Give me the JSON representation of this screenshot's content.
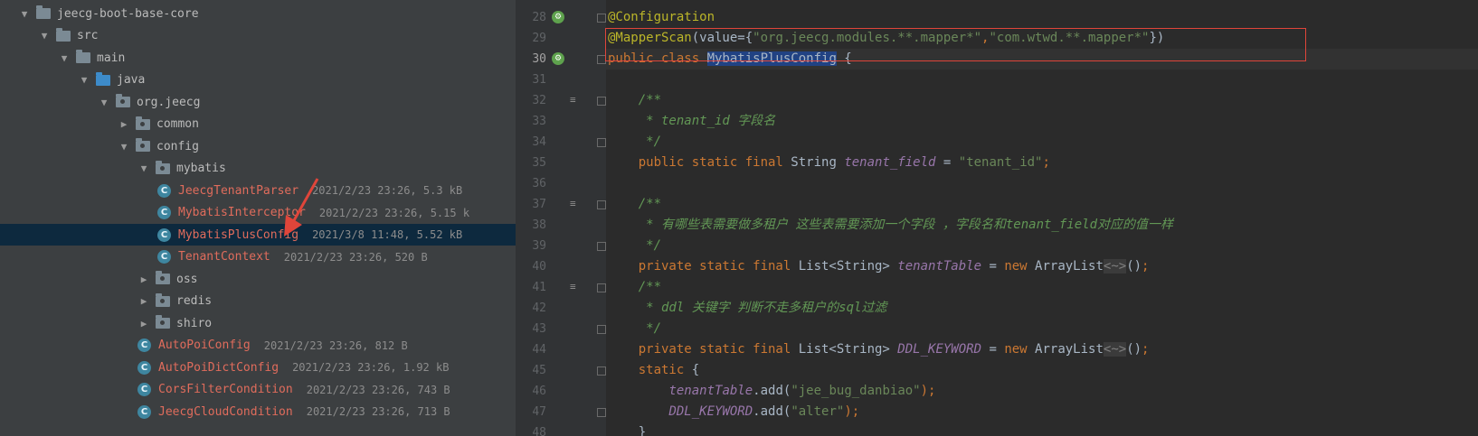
{
  "project_tree": {
    "rows": [
      {
        "label": "jeecg-boot-base-core",
        "meta": "",
        "expanded": true,
        "icon": "module-folder-icon",
        "depth": 0
      },
      {
        "label": "src",
        "meta": "",
        "expanded": true,
        "icon": "folder-icon",
        "depth": 1
      },
      {
        "label": "main",
        "meta": "",
        "expanded": true,
        "icon": "folder-icon",
        "depth": 2
      },
      {
        "label": "java",
        "meta": "",
        "expanded": true,
        "icon": "source-folder-icon",
        "depth": 3
      },
      {
        "label": "org.jeecg",
        "meta": "",
        "expanded": true,
        "icon": "package-icon",
        "depth": 4
      },
      {
        "label": "common",
        "meta": "",
        "expanded": false,
        "icon": "package-icon",
        "depth": 5
      },
      {
        "label": "config",
        "meta": "",
        "expanded": true,
        "icon": "package-icon",
        "depth": 5
      },
      {
        "label": "mybatis",
        "meta": "",
        "expanded": true,
        "icon": "package-icon",
        "depth": 6
      },
      {
        "label": "JeecgTenantParser",
        "meta": "2021/2/23 23:26, 5.3 kB",
        "icon": "class-icon",
        "depth": 7
      },
      {
        "label": "MybatisInterceptor",
        "meta": "2021/2/23 23:26, 5.15 k",
        "icon": "class-icon",
        "depth": 7
      },
      {
        "label": "MybatisPlusConfig",
        "meta": "2021/3/8 11:48, 5.52 kB",
        "icon": "class-icon",
        "depth": 7,
        "selected": true
      },
      {
        "label": "TenantContext",
        "meta": "2021/2/23 23:26, 520 B",
        "icon": "class-icon",
        "depth": 7
      },
      {
        "label": "oss",
        "meta": "",
        "expanded": false,
        "icon": "package-icon",
        "depth": 6
      },
      {
        "label": "redis",
        "meta": "",
        "expanded": false,
        "icon": "package-icon",
        "depth": 6
      },
      {
        "label": "shiro",
        "meta": "",
        "expanded": false,
        "icon": "package-icon",
        "depth": 6
      },
      {
        "label": "AutoPoiConfig",
        "meta": "2021/2/23 23:26, 812 B",
        "icon": "class-icon",
        "depth": 6
      },
      {
        "label": "AutoPoiDictConfig",
        "meta": "2021/2/23 23:26, 1.92 kB",
        "icon": "class-icon",
        "depth": 6
      },
      {
        "label": "CorsFilterCondition",
        "meta": "2021/2/23 23:26, 743 B",
        "icon": "class-icon",
        "depth": 6
      },
      {
        "label": "JeecgCloudCondition",
        "meta": "2021/2/23 23:26, 713 B",
        "icon": "class-icon",
        "depth": 6
      }
    ],
    "class_icon_letter": "C"
  },
  "editor": {
    "current_line": "30",
    "lines": [
      {
        "num": "28",
        "segments": [
          {
            "t": "@Configuration",
            "c": "ann"
          }
        ]
      },
      {
        "num": "29",
        "segments": [
          {
            "t": "@MapperScan",
            "c": "ann"
          },
          {
            "t": "(value={",
            "c": ""
          },
          {
            "t": "\"org.jeecg.modules.**.mapper*\"",
            "c": "str"
          },
          {
            "t": ",",
            "c": "k"
          },
          {
            "t": "\"com.wtwd.**.mapper*\"",
            "c": "str"
          },
          {
            "t": "})",
            "c": ""
          }
        ]
      },
      {
        "num": "30",
        "segments": [
          {
            "t": "public class ",
            "c": "k"
          },
          {
            "t": "MybatisPlusConfig",
            "c": "hl"
          },
          {
            "t": " {",
            "c": ""
          }
        ]
      },
      {
        "num": "31",
        "segments": []
      },
      {
        "num": "32",
        "segments": [
          {
            "t": "    /**",
            "c": "cmt"
          }
        ]
      },
      {
        "num": "33",
        "segments": [
          {
            "t": "     * tenant_id 字段名",
            "c": "cmt"
          }
        ]
      },
      {
        "num": "34",
        "segments": [
          {
            "t": "     */",
            "c": "cmt"
          }
        ]
      },
      {
        "num": "35",
        "segments": [
          {
            "t": "    public static final ",
            "c": "k"
          },
          {
            "t": "String ",
            "c": ""
          },
          {
            "t": "tenant_field",
            "c": "fld"
          },
          {
            "t": " = ",
            "c": ""
          },
          {
            "t": "\"tenant_id\"",
            "c": "str"
          },
          {
            "t": ";",
            "c": "k"
          }
        ]
      },
      {
        "num": "36",
        "segments": []
      },
      {
        "num": "37",
        "segments": [
          {
            "t": "    /**",
            "c": "cmt"
          }
        ]
      },
      {
        "num": "38",
        "segments": [
          {
            "t": "     * 有哪些表需要做多租户 这些表需要添加一个字段 ，字段名和tenant_field对应的值一样",
            "c": "cmt"
          }
        ]
      },
      {
        "num": "39",
        "segments": [
          {
            "t": "     */",
            "c": "cmt"
          }
        ]
      },
      {
        "num": "40",
        "segments": [
          {
            "t": "    private static final ",
            "c": "k"
          },
          {
            "t": "List<String> ",
            "c": ""
          },
          {
            "t": "tenantTable",
            "c": "fld"
          },
          {
            "t": " = ",
            "c": ""
          },
          {
            "t": "new ",
            "c": "k"
          },
          {
            "t": "ArrayList",
            "c": ""
          },
          {
            "t": "<~>",
            "c": "dim"
          },
          {
            "t": "()",
            "c": ""
          },
          {
            "t": ";",
            "c": "k"
          }
        ]
      },
      {
        "num": "41",
        "segments": [
          {
            "t": "    /**",
            "c": "cmt"
          }
        ]
      },
      {
        "num": "42",
        "segments": [
          {
            "t": "     * ddl 关键字 判断不走多租户的sql过滤",
            "c": "cmt"
          }
        ]
      },
      {
        "num": "43",
        "segments": [
          {
            "t": "     */",
            "c": "cmt"
          }
        ]
      },
      {
        "num": "44",
        "segments": [
          {
            "t": "    private static final ",
            "c": "k"
          },
          {
            "t": "List<String> ",
            "c": ""
          },
          {
            "t": "DDL_KEYWORD",
            "c": "fld"
          },
          {
            "t": " = ",
            "c": ""
          },
          {
            "t": "new ",
            "c": "k"
          },
          {
            "t": "ArrayList",
            "c": ""
          },
          {
            "t": "<~>",
            "c": "dim"
          },
          {
            "t": "()",
            "c": ""
          },
          {
            "t": ";",
            "c": "k"
          }
        ]
      },
      {
        "num": "45",
        "segments": [
          {
            "t": "    static ",
            "c": "k"
          },
          {
            "t": "{",
            "c": ""
          }
        ]
      },
      {
        "num": "46",
        "segments": [
          {
            "t": "        ",
            "c": ""
          },
          {
            "t": "tenantTable",
            "c": "fld"
          },
          {
            "t": ".add(",
            "c": ""
          },
          {
            "t": "\"jee_bug_danbiao\"",
            "c": "str"
          },
          {
            "t": ");",
            "c": "k"
          }
        ]
      },
      {
        "num": "47",
        "segments": [
          {
            "t": "        ",
            "c": ""
          },
          {
            "t": "DDL_KEYWORD",
            "c": "fld"
          },
          {
            "t": ".add(",
            "c": ""
          },
          {
            "t": "\"alter\"",
            "c": "str"
          },
          {
            "t": ");",
            "c": "k"
          }
        ]
      },
      {
        "num": "48",
        "segments": [
          {
            "t": "    }",
            "c": ""
          }
        ]
      }
    ],
    "bean_icon_lines": [
      "28",
      "30"
    ],
    "doc_lines": [
      "32",
      "37",
      "41"
    ],
    "fold_lines": [
      "28",
      "30",
      "32",
      "34",
      "37",
      "39",
      "41",
      "43",
      "45",
      "47"
    ]
  },
  "colors": {
    "annotation_red": "#e0453a",
    "selection_bg": "#0d293e",
    "editor_bg": "#2b2b2b",
    "tree_bg": "#3c3f41"
  }
}
